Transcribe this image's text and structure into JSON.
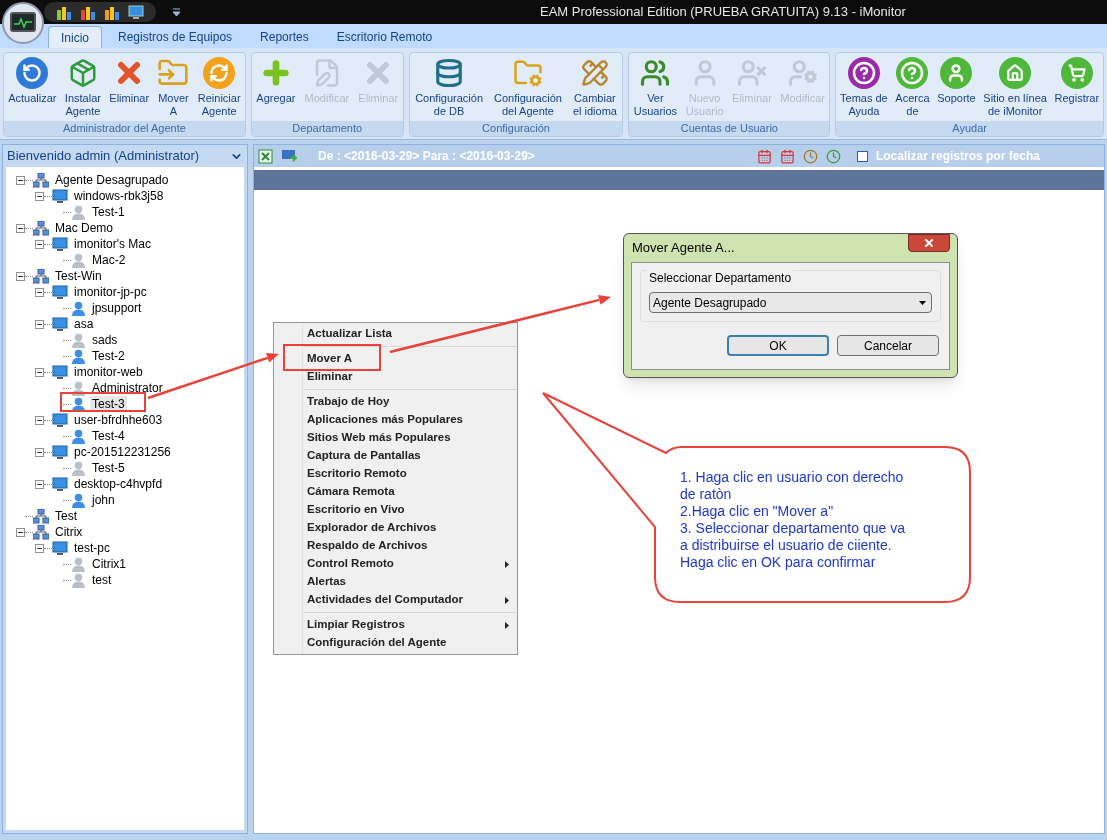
{
  "window": {
    "title": "EAM Professional Edition (PRUEBA GRATUITA) 9.13 - iMonitor"
  },
  "tabs": [
    {
      "label": "Inicio",
      "selected": true
    },
    {
      "label": "Registros de Equipos",
      "selected": false
    },
    {
      "label": "Reportes",
      "selected": false
    },
    {
      "label": "Escritorio Remoto",
      "selected": false
    }
  ],
  "ribbon": {
    "groups": [
      {
        "label": "Administrador del Agente",
        "buttons": [
          {
            "label_lines": [
              "Actualizar"
            ],
            "disabled": false
          },
          {
            "label_lines": [
              "Instalar",
              "Agente"
            ],
            "disabled": false
          },
          {
            "label_lines": [
              "Eliminar"
            ],
            "disabled": false
          },
          {
            "label_lines": [
              "Mover",
              "A"
            ],
            "disabled": false
          },
          {
            "label_lines": [
              "Reiniciar",
              "Agente"
            ],
            "disabled": false
          }
        ]
      },
      {
        "label": "Departamento",
        "buttons": [
          {
            "label_lines": [
              "Agregar"
            ],
            "disabled": false
          },
          {
            "label_lines": [
              "Modificar"
            ],
            "disabled": true
          },
          {
            "label_lines": [
              "Eliminar"
            ],
            "disabled": true
          }
        ]
      },
      {
        "label": "Configuración",
        "buttons": [
          {
            "label_lines": [
              "Configuración",
              "de DB"
            ],
            "disabled": false
          },
          {
            "label_lines": [
              "Configuración",
              "del Agente"
            ],
            "disabled": false
          },
          {
            "label_lines": [
              "Cambiar",
              "el idioma"
            ],
            "disabled": false
          }
        ]
      },
      {
        "label": "Cuentas de Usuario",
        "buttons": [
          {
            "label_lines": [
              "Ver",
              "Usuarios"
            ],
            "disabled": false
          },
          {
            "label_lines": [
              "Nuevo",
              "Usuario"
            ],
            "disabled": true
          },
          {
            "label_lines": [
              "Eliminar"
            ],
            "disabled": true
          },
          {
            "label_lines": [
              "Modificar"
            ],
            "disabled": true
          }
        ]
      },
      {
        "label": "Ayudar",
        "buttons": [
          {
            "label_lines": [
              "Temas de",
              "Ayuda"
            ],
            "disabled": false
          },
          {
            "label_lines": [
              "Acerca",
              "de"
            ],
            "disabled": false
          },
          {
            "label_lines": [
              "Soporte"
            ],
            "disabled": false
          },
          {
            "label_lines": [
              "Sitio en línea",
              "de iMonitor"
            ],
            "disabled": false
          },
          {
            "label_lines": [
              "Registrar"
            ],
            "disabled": false
          }
        ]
      }
    ]
  },
  "sidebar": {
    "title": "Bienvenido admin (Administrator)",
    "tree": [
      {
        "label": "Agente Desagrupado",
        "kind": "group",
        "selected": false,
        "expanded": true,
        "children": [
          {
            "label": "windows-rbk3j58",
            "kind": "computer",
            "selected": false,
            "expanded": true,
            "children": [
              {
                "label": "Test-1",
                "kind": "user",
                "active": false,
                "selected": false
              }
            ]
          }
        ]
      },
      {
        "label": "Mac Demo",
        "kind": "group",
        "selected": false,
        "expanded": true,
        "children": [
          {
            "label": "imonitor's Mac",
            "kind": "computer",
            "selected": false,
            "expanded": true,
            "children": [
              {
                "label": "Mac-2",
                "kind": "user",
                "active": false,
                "selected": false
              }
            ]
          }
        ]
      },
      {
        "label": "Test-Win",
        "kind": "group",
        "selected": false,
        "expanded": true,
        "children": [
          {
            "label": "imonitor-jp-pc",
            "kind": "computer",
            "selected": false,
            "expanded": true,
            "children": [
              {
                "label": "jpsupport",
                "kind": "user",
                "active": true,
                "selected": false
              }
            ]
          },
          {
            "label": "asa",
            "kind": "computer",
            "selected": false,
            "expanded": true,
            "children": [
              {
                "label": "sads",
                "kind": "user",
                "active": false,
                "selected": false
              },
              {
                "label": "Test-2",
                "kind": "user",
                "active": true,
                "selected": false
              }
            ]
          },
          {
            "label": "imonitor-web",
            "kind": "computer",
            "selected": false,
            "expanded": true,
            "children": [
              {
                "label": "Administrator",
                "kind": "user",
                "active": false,
                "selected": false
              },
              {
                "label": "Test-3",
                "kind": "user",
                "active": true,
                "selected": true
              }
            ]
          },
          {
            "label": "user-bfrdhhe603",
            "kind": "computer",
            "selected": false,
            "expanded": true,
            "children": [
              {
                "label": "Test-4",
                "kind": "user",
                "active": true,
                "selected": false
              }
            ]
          },
          {
            "label": "pc-201512231256",
            "kind": "computer",
            "selected": false,
            "expanded": true,
            "children": [
              {
                "label": "Test-5",
                "kind": "user",
                "active": false,
                "selected": false
              }
            ]
          },
          {
            "label": "desktop-c4hvpfd",
            "kind": "computer",
            "selected": false,
            "expanded": true,
            "children": [
              {
                "label": "john",
                "kind": "user",
                "active": true,
                "selected": false
              }
            ]
          }
        ]
      },
      {
        "label": "Test",
        "kind": "group",
        "selected": false
      },
      {
        "label": "Citrix",
        "kind": "group",
        "selected": false,
        "expanded": true,
        "children": [
          {
            "label": "test-pc",
            "kind": "computer",
            "selected": false,
            "expanded": true,
            "children": [
              {
                "label": "Citrix1",
                "kind": "user",
                "active": false,
                "selected": false
              },
              {
                "label": "test",
                "kind": "user",
                "active": false,
                "selected": false
              }
            ]
          }
        ]
      }
    ]
  },
  "toolbar": {
    "date_range": "De : <2016-03-29> Para : <2016-03-29>",
    "filter_checkbox": {
      "label": "Localizar registros por fecha",
      "checked": false
    }
  },
  "context_menu": {
    "sections": [
      [
        {
          "label": "Actualizar Lista",
          "has_submenu": false
        }
      ],
      [
        {
          "label": "Mover A",
          "has_submenu": false
        },
        {
          "label": "Eliminar",
          "has_submenu": false
        }
      ],
      [
        {
          "label": "Trabajo de Hoy",
          "has_submenu": false
        },
        {
          "label": "Aplicaciones más Populares",
          "has_submenu": false
        },
        {
          "label": "Sitios Web más Populares",
          "has_submenu": false
        },
        {
          "label": "Captura de Pantallas",
          "has_submenu": false
        },
        {
          "label": "Escritorio Remoto",
          "has_submenu": false
        },
        {
          "label": "Cámara Remota",
          "has_submenu": false
        },
        {
          "label": "Escritorio en Vivo",
          "has_submenu": false
        },
        {
          "label": "Explorador de Archivos",
          "has_submenu": false
        },
        {
          "label": "Respaldo de Archivos",
          "has_submenu": false
        },
        {
          "label": "Control Remoto",
          "has_submenu": true
        },
        {
          "label": "Alertas",
          "has_submenu": false
        },
        {
          "label": "Actividades del Computador",
          "has_submenu": true
        }
      ],
      [
        {
          "label": "Limpiar Registros",
          "has_submenu": true
        },
        {
          "label": "Configuración del Agente",
          "has_submenu": false
        }
      ]
    ]
  },
  "dialog": {
    "title": "Mover Agente A...",
    "group_label": "Seleccionar Departamento",
    "select_value": "Agente Desagrupado",
    "buttons": [
      {
        "label": "OK",
        "default": true
      },
      {
        "label": "Cancelar",
        "default": false
      }
    ]
  },
  "annotation": {
    "callout_text": "1. Haga clic en usuario con derecho\nde ratòn\n2.Haga clic en \"Mover a\"\n3. Seleccionar departamento que va\na distribuirse el usuario de ciiente.\nHaga clic en OK para confirmar"
  }
}
